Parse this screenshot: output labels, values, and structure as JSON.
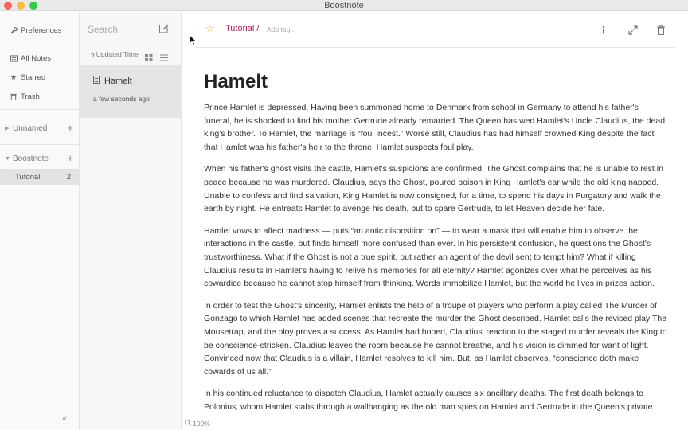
{
  "window": {
    "title": "Boostnote"
  },
  "sidebar": {
    "items": [
      {
        "label": "Preferences",
        "icon": "wrench-icon"
      },
      {
        "label": "All Notes",
        "icon": "notes-icon"
      },
      {
        "label": "Starred",
        "icon": "star-icon"
      },
      {
        "label": "Trash",
        "icon": "trash-icon"
      }
    ],
    "storages": [
      {
        "name": "Unnamed"
      },
      {
        "name": "Boostnote"
      }
    ],
    "folder": {
      "name": "Tutorial",
      "count": "2"
    }
  },
  "notelist": {
    "search_placeholder": "Search",
    "sort_label": "Updated Time",
    "notes": [
      {
        "title": "Hamelt",
        "date": "a few seconds ago"
      }
    ]
  },
  "editor": {
    "folder_crumb": "Tutorial /",
    "tag_placeholder": "Add tag...",
    "zoom": "100%",
    "title": "Hamelt",
    "paragraphs": [
      "Prince Hamlet is depressed. Having been summoned home to Denmark from school in Germany to attend his father's funeral, he is shocked to find his mother Gertrude already remarried. The Queen has wed Hamlet's Uncle Claudius, the dead king's brother. To Hamlet, the marriage is “foul incest.” Worse still, Claudius has had himself crowned King despite the fact that Hamlet was his father's heir to the throne. Hamlet suspects foul play.",
      "When his father's ghost visits the castle, Hamlet's suspicions are confirmed. The Ghost complains that he is unable to rest in peace because he was murdered. Claudius, says the Ghost, poured poison in King Hamlet's ear while the old king napped. Unable to confess and find salvation, King Hamlet is now consigned, for a time, to spend his days in Purgatory and walk the earth by night. He entreats Hamlet to avenge his death, but to spare Gertrude, to let Heaven decide her fate.",
      "Hamlet vows to affect madness — puts “an antic disposition on” — to wear a mask that will enable him to observe the interactions in the castle, but finds himself more confused than ever. In his persistent confusion, he questions the Ghost's trustworthiness. What if the Ghost is not a true spirit, but rather an agent of the devil sent to tempt him? What if killing Claudius results in Hamlet's having to relive his memories for all eternity? Hamlet agonizes over what he perceives as his cowardice because he cannot stop himself from thinking. Words immobilize Hamlet, but the world he lives in prizes action.",
      "In order to test the Ghost's sincerity, Hamlet enlists the help of a troupe of players who perform a play called The Murder of Gonzago to which Hamlet has added scenes that recreate the murder the Ghost described. Hamlet calls the revised play The Mousetrap, and the ploy proves a success. As Hamlet had hoped, Claudius' reaction to the staged murder reveals the King to be conscience-stricken. Claudius leaves the room because he cannot breathe, and his vision is dimmed for want of light. Convinced now that Claudius is a villain, Hamlet resolves to kill him. But, as Hamlet observes, “conscience doth make cowards of us all.”",
      "In his continued reluctance to dispatch Claudius, Hamlet actually causes six ancillary deaths. The first death belongs to Polonius, whom Hamlet stabs through a wallhanging as the old man spies on Hamlet and Gertrude in the Queen's private"
    ]
  },
  "colors": {
    "accent": "#b01c5b",
    "star": "#f5b62c",
    "selected": "#e4e4e4"
  }
}
